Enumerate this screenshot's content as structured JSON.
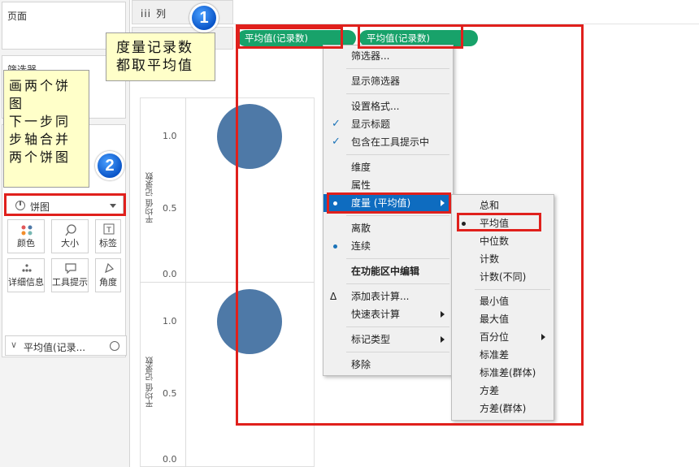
{
  "panels": {
    "pages_title": "页面",
    "filters_title": "筛选器",
    "columns_label": "列",
    "columns_icon": "iii"
  },
  "marks": {
    "type_label": "饼图",
    "buttons": [
      {
        "label": "颜色",
        "icon": "color-dots-icon"
      },
      {
        "label": "大小",
        "icon": "size-icon"
      },
      {
        "label": "标签",
        "icon": "label-icon"
      },
      {
        "label": "详细信息",
        "icon": "detail-icon"
      },
      {
        "label": "工具提示",
        "icon": "tooltip-icon"
      },
      {
        "label": "角度",
        "icon": "angle-icon"
      }
    ],
    "angle_pill": "平均值(记录..."
  },
  "shelf": {
    "pill_1": "平均值(记录数)",
    "pill_2": "平均值(记录数)"
  },
  "chart": {
    "axis_title": "平均值 记录数",
    "ticks": [
      "1.0",
      "0.5",
      "0.0",
      "1.0",
      "0.5",
      "0.0"
    ],
    "circle_color": "#4e79a7"
  },
  "callouts": {
    "c1_line1": "度量记录数",
    "c1_line2": "都取平均值",
    "c2_lines": [
      "画两个饼",
      "图",
      "下一步同",
      "步轴合并",
      "两个饼图"
    ],
    "badge1": "1",
    "badge2": "2"
  },
  "context_menu": {
    "items": [
      "筛选器...",
      "显示筛选器",
      "设置格式...",
      "显示标题",
      "包含在工具提示中",
      "维度",
      "属性",
      "度量 (平均值)",
      "离散",
      "连续",
      "在功能区中编辑",
      "添加表计算...",
      "快速表计算",
      "标记类型",
      "移除"
    ],
    "delta_symbol": "Δ"
  },
  "submenu": {
    "items": [
      "总和",
      "平均值",
      "中位数",
      "计数",
      "计数(不同)",
      "最小值",
      "最大值",
      "百分位",
      "标准差",
      "标准差(群体)",
      "方差",
      "方差(群体)"
    ]
  }
}
